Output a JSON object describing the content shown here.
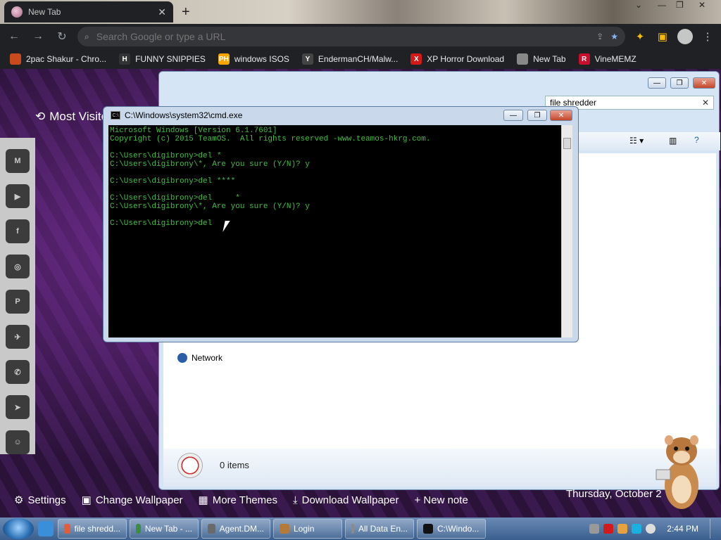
{
  "chrome": {
    "tab": {
      "title": "New Tab"
    },
    "omnibox": {
      "placeholder": "Search Google or type a URL"
    },
    "bookmarks": [
      {
        "label": "2pac Shakur - Chro...",
        "icon_text": "",
        "color": "#c94a1c"
      },
      {
        "label": "FUNNY SNIPPIES",
        "icon_text": "H",
        "color": "#333333"
      },
      {
        "label": "windows ISOS",
        "icon_text": "PH",
        "color": "#f7a600"
      },
      {
        "label": "EndermanCH/Malw...",
        "icon_text": "Y",
        "color": "#444444"
      },
      {
        "label": "XP Horror Download",
        "icon_text": "X",
        "color": "#d21a1a"
      },
      {
        "label": "New Tab",
        "icon_text": "",
        "color": "#888888"
      },
      {
        "label": "VineMEMZ",
        "icon_text": "R",
        "color": "#c8102e"
      }
    ]
  },
  "ntp": {
    "most_visited": "Most Visite",
    "bottom": {
      "settings": "Settings",
      "change_wallpaper": "Change Wallpaper",
      "more_themes": "More Themes",
      "download_wallpaper": "Download Wallpaper",
      "new_note": "+ New note"
    },
    "date": "Thursday, October 2"
  },
  "explorer": {
    "search_value": "file shredder",
    "nav_item": "Network",
    "item_count": "0 items"
  },
  "cmd": {
    "title": "C:\\Windows\\system32\\cmd.exe",
    "lines": [
      "Microsoft Windows [Version 6.1.7601]",
      "Copyright (c) 2015 TeamOS.  All rights reserved -www.teamos-hkrg.com.",
      "",
      "C:\\Users\\digibrony>del *",
      "C:\\Users\\digibrony\\*, Are you sure (Y/N)? y",
      "",
      "C:\\Users\\digibrony>del ****",
      "",
      "C:\\Users\\digibrony>del     *",
      "C:\\Users\\digibrony\\*, Are you sure (Y/N)? y",
      "",
      "C:\\Users\\digibrony>del"
    ]
  },
  "taskbar": {
    "buttons": [
      {
        "label": "file shredd...",
        "color": "#e35d3a"
      },
      {
        "label": "New Tab - ...",
        "color": "#3c8d40"
      },
      {
        "label": "Agent.DM...",
        "color": "#6a6a6a"
      },
      {
        "label": "Login",
        "color": "#b37a3a"
      },
      {
        "label": "All Data En...",
        "color": "#8a8a8a"
      },
      {
        "label": "C:\\Windo...",
        "color": "#111111"
      }
    ],
    "clock": "2:44 PM"
  }
}
